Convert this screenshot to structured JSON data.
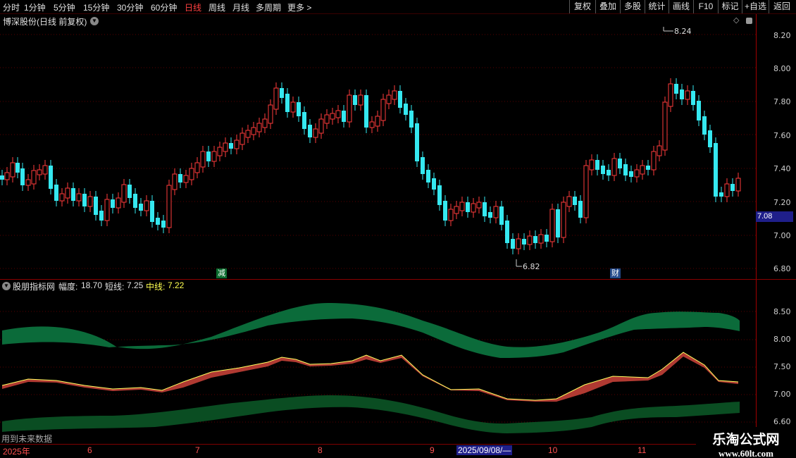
{
  "toolbar": {
    "periods": [
      "分时",
      "1分钟",
      "5分钟",
      "15分钟",
      "30分钟",
      "60分钟",
      "日线",
      "周线",
      "月线",
      "多周期",
      "更多 >"
    ],
    "active_period": "日线",
    "right_buttons": [
      "复权",
      "叠加",
      "多股",
      "统计",
      "画线",
      "F10",
      "标记",
      "+自选",
      "返回"
    ]
  },
  "main_panel": {
    "title": "博深股份(日线 前复权)",
    "price_labels": [
      "8.20",
      "8.00",
      "7.80",
      "7.60",
      "7.40",
      "7.20",
      "7.00",
      "6.80"
    ],
    "current_price": "7.08",
    "high_marker": "8.24",
    "low_marker": "6.82",
    "event_markers": [
      "减",
      "财"
    ]
  },
  "indicator_panel": {
    "name": "股朋指标网",
    "fields": [
      {
        "label": "幅度:",
        "value": "18.70"
      },
      {
        "label": "短线:",
        "value": "7.25"
      },
      {
        "label": "中线:",
        "value": "7.22"
      }
    ],
    "axis_labels": [
      "8.50",
      "8.00",
      "7.50",
      "7.00",
      "6.60"
    ],
    "footer_note": "用到未来数据"
  },
  "date_axis": {
    "ticks": [
      "2025年",
      "6",
      "7",
      "8",
      "9",
      "10",
      "11"
    ],
    "selected_date": "2025/09/08/—"
  },
  "watermark": {
    "line1": "乐淘公式网",
    "line2": "www.60lt.com"
  },
  "colors": {
    "up": "#ff3b3b",
    "down": "#35e8f0",
    "band": "#0b6b3a",
    "band_lower": "#0a4d22",
    "short_line": "#ffff60",
    "fill_between": "#b03a32",
    "axis": "#a00000"
  },
  "icons": [
    "chevron-down-icon",
    "diamond-icon",
    "square-icon"
  ]
}
